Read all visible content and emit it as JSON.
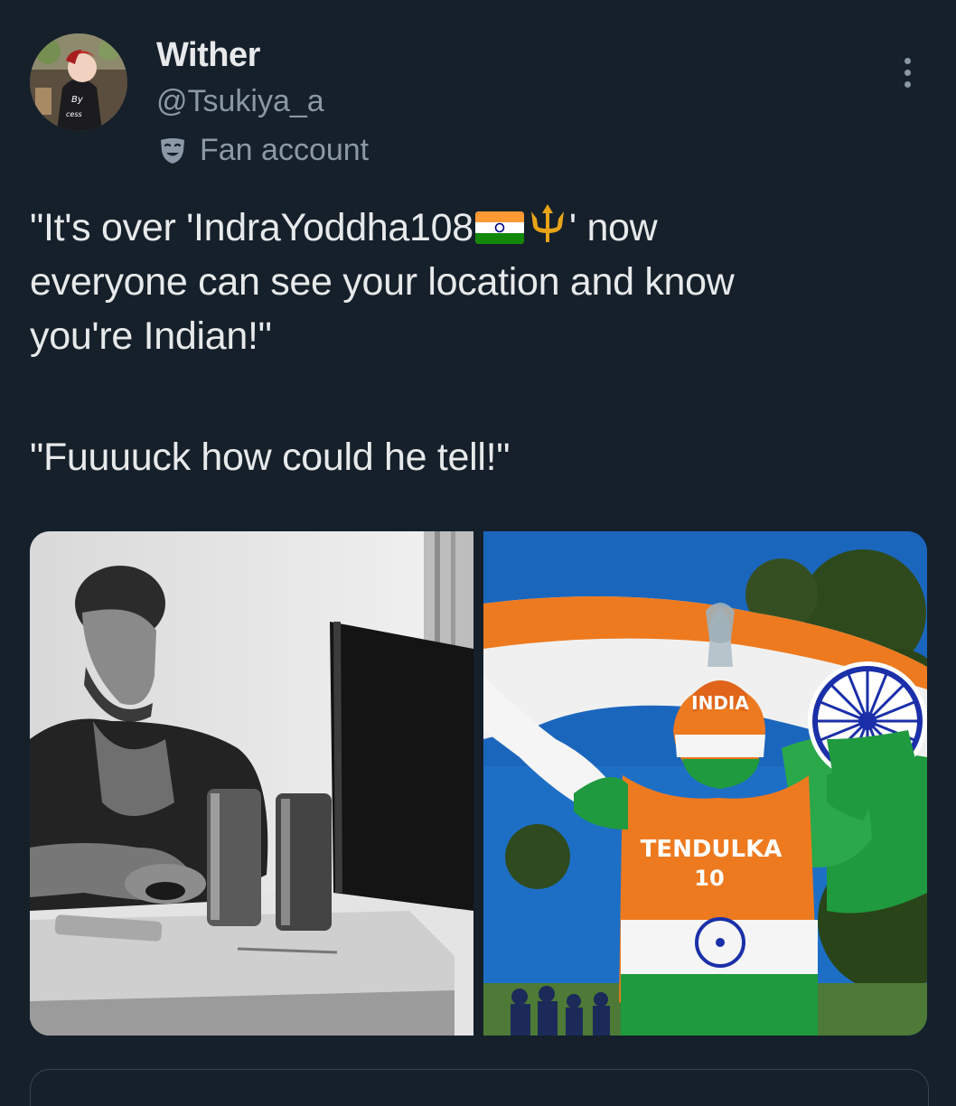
{
  "author": {
    "display_name": "Wither",
    "handle": "@Tsukiya_a",
    "label": "Fan account",
    "label_icon": "theater-mask-icon",
    "avatar": "anime-character-avatar"
  },
  "tweet": {
    "line1_before": "\"It's over 'IndraYoddha108",
    "line1_after": "' now",
    "line2": "everyone can see your location and know",
    "line3": "you're Indian!\"",
    "line4": "\"Fuuuuck how could he tell!\"",
    "inline_emojis": [
      "india-flag-emoji",
      "trident-emoji"
    ]
  },
  "media": {
    "left_image": "black-and-white-man-at-computer-photo",
    "right_image": "cricket-fan-with-india-flag-photo",
    "right_image_text": {
      "cap": "INDIA",
      "chest": "TENDULKA",
      "number": "10"
    }
  },
  "colors": {
    "background": "#15202b",
    "text_primary": "#e7e9ea",
    "text_secondary": "#8b98a5",
    "border": "#38444d"
  }
}
